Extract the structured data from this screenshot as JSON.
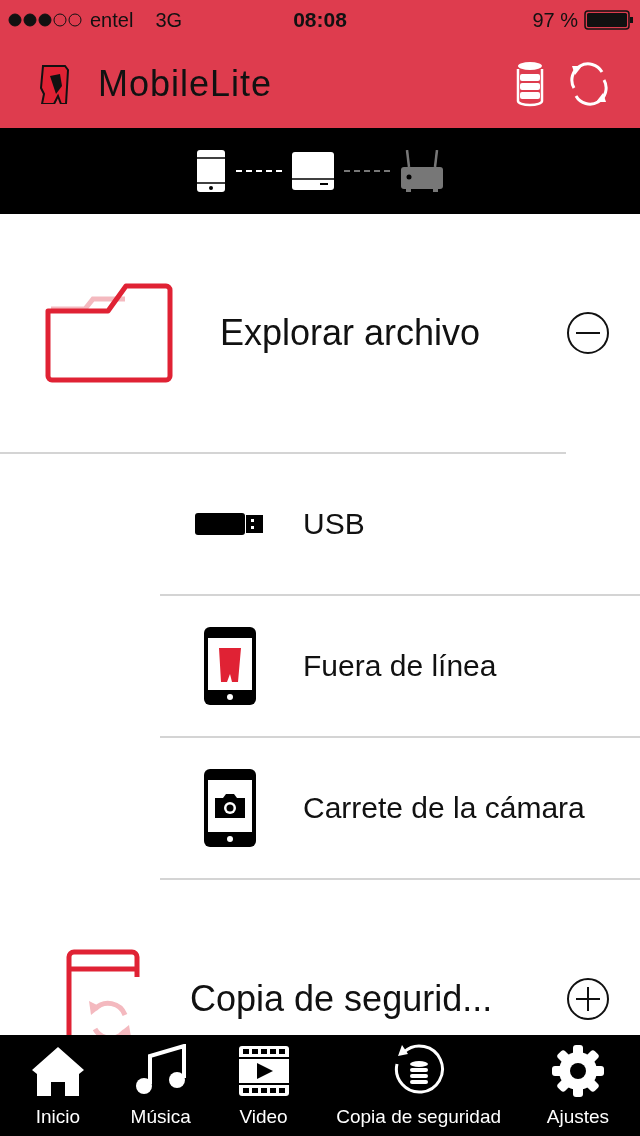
{
  "status_bar": {
    "carrier": "entel",
    "network": "3G",
    "time": "08:08",
    "battery": "97 %"
  },
  "header": {
    "title": "MobileLite"
  },
  "connection": [
    {
      "kind": "phone",
      "active": true
    },
    {
      "kind": "drive",
      "active": true
    },
    {
      "kind": "router",
      "active": false
    }
  ],
  "sections": [
    {
      "kind": "explore",
      "title": "Explorar archivo",
      "expanded": true,
      "items": [
        {
          "kind": "usb",
          "label": "USB"
        },
        {
          "kind": "offline",
          "label": "Fuera de línea"
        },
        {
          "kind": "camera",
          "label": "Carrete de la cámara"
        }
      ]
    },
    {
      "kind": "backup",
      "title": "Copia de segurid...",
      "expanded": false
    }
  ],
  "tabs": [
    {
      "kind": "home",
      "label": "Inicio"
    },
    {
      "kind": "music",
      "label": "Música"
    },
    {
      "kind": "video",
      "label": "Video"
    },
    {
      "kind": "backup",
      "label": "Copia de seguridad"
    },
    {
      "kind": "settings",
      "label": "Ajustes"
    }
  ]
}
